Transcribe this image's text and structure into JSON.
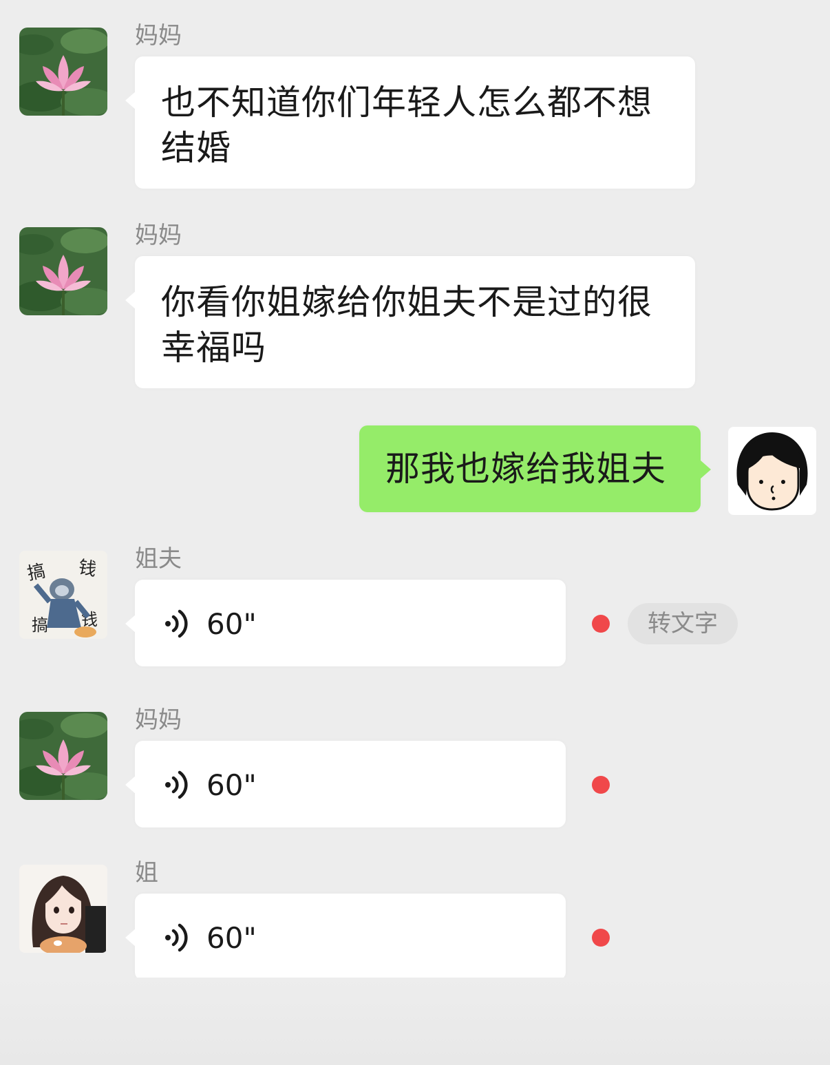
{
  "colors": {
    "background": "#ededed",
    "bubble_incoming": "#ffffff",
    "bubble_outgoing": "#95ec69",
    "unread_dot": "#f0484a",
    "sender_name": "#8a8a8a"
  },
  "messages": [
    {
      "sender": "妈妈",
      "avatar": "lotus-avatar",
      "type": "text",
      "text": "也不知道你们年轻人怎么都不想结婚"
    },
    {
      "sender": "妈妈",
      "avatar": "lotus-avatar",
      "type": "text",
      "text": "你看你姐嫁给你姐夫不是过的很幸福吗"
    },
    {
      "sender": "",
      "avatar": "cartoon-girl-avatar",
      "type": "text",
      "outgoing": true,
      "text": "那我也嫁给我姐夫"
    },
    {
      "sender": "姐夫",
      "avatar": "meme-avatar",
      "type": "voice",
      "duration": "60\"",
      "unread": true,
      "action_label": "转文字"
    },
    {
      "sender": "妈妈",
      "avatar": "lotus-avatar",
      "type": "voice",
      "duration": "60\"",
      "unread": true
    },
    {
      "sender": "姐",
      "avatar": "anime-girl-avatar",
      "type": "voice",
      "duration": "60\"",
      "unread": true
    }
  ]
}
